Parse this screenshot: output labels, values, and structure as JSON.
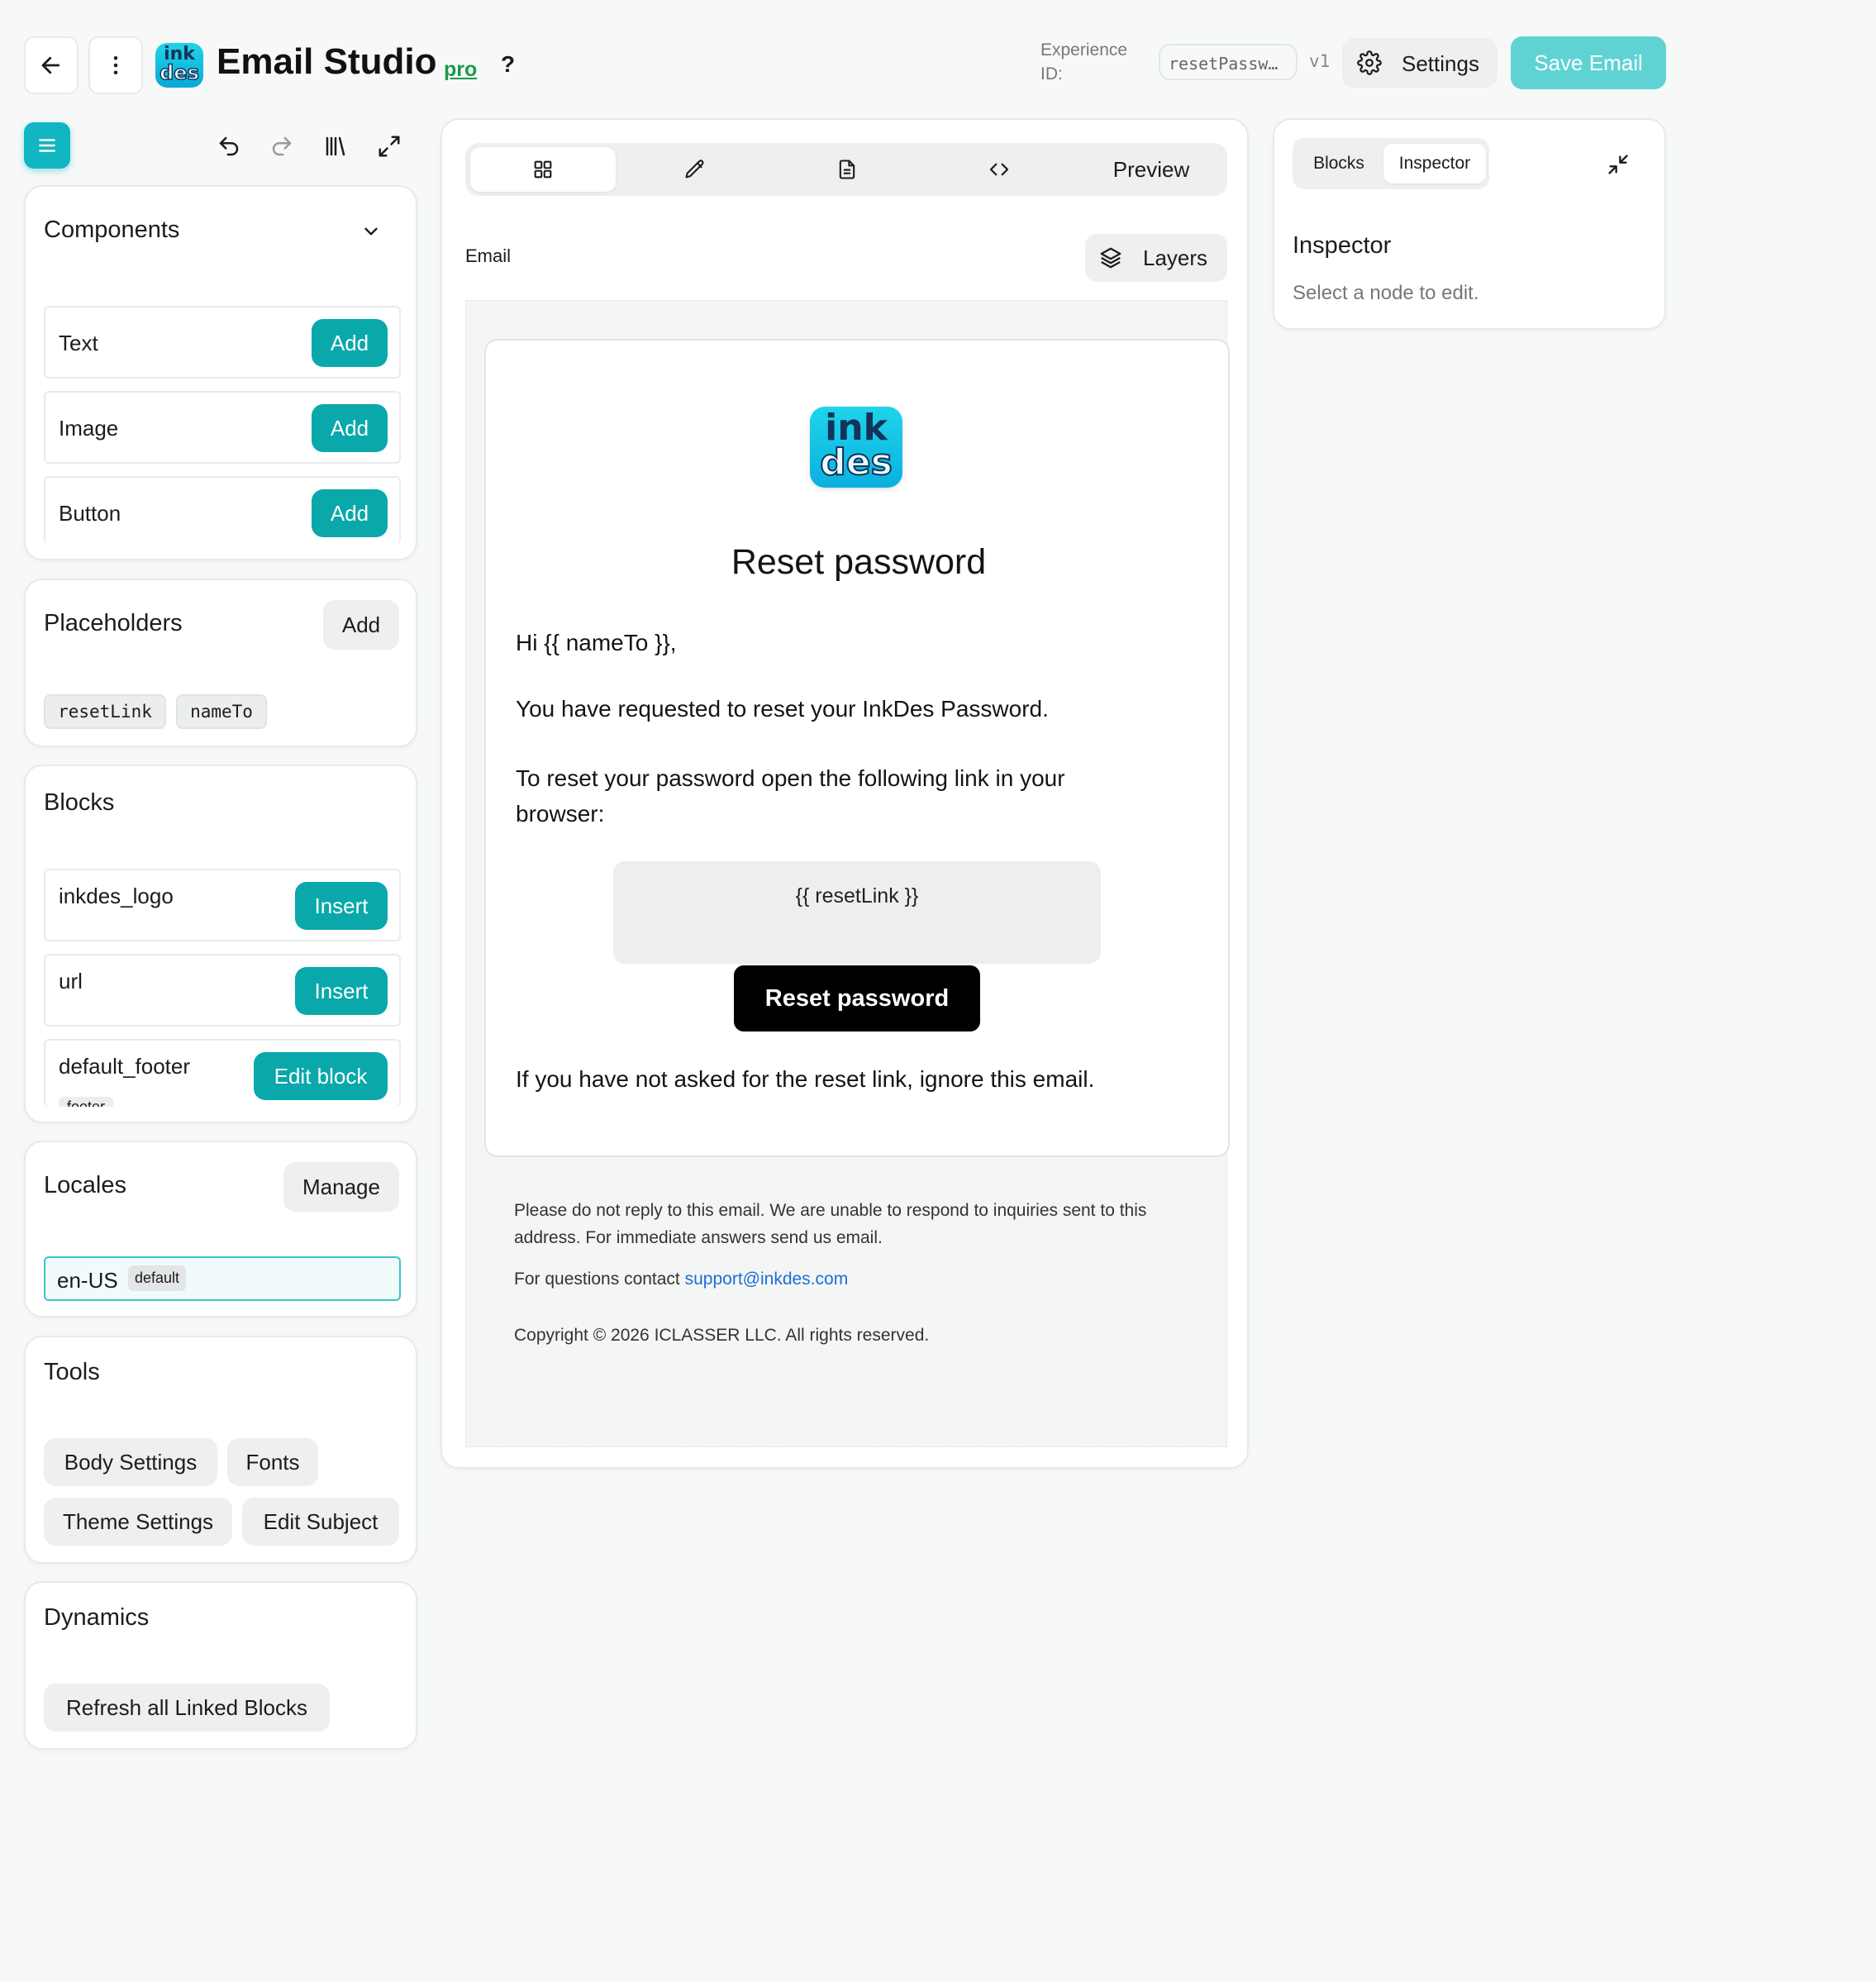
{
  "header": {
    "app_title": "Email Studio",
    "pro_badge": "pro",
    "help_label": "?",
    "logo_text_top": "ink",
    "logo_text_bottom": "des",
    "experience_id_label": "Experience ID:",
    "experience_id_value": "resetPassw…",
    "version": "v1",
    "settings_label": "Settings",
    "save_label": "Save Email"
  },
  "left": {
    "components": {
      "title": "Components",
      "items": [
        {
          "label": "Text",
          "action": "Add"
        },
        {
          "label": "Image",
          "action": "Add"
        },
        {
          "label": "Button",
          "action": "Add"
        }
      ]
    },
    "placeholders": {
      "title": "Placeholders",
      "add_label": "Add",
      "chips": [
        "resetLink",
        "nameTo"
      ]
    },
    "blocks": {
      "title": "Blocks",
      "items": [
        {
          "label": "inkdes_logo",
          "action": "Insert"
        },
        {
          "label": "url",
          "action": "Insert"
        },
        {
          "label": "default_footer",
          "action": "Edit block",
          "tag": "footer"
        }
      ]
    },
    "locales": {
      "title": "Locales",
      "manage_label": "Manage",
      "locale": "en-US",
      "locale_tag": "default"
    },
    "tools": {
      "title": "Tools",
      "buttons": [
        "Body Settings",
        "Fonts",
        "Theme Settings",
        "Edit Subject"
      ]
    },
    "dynamics": {
      "title": "Dynamics",
      "refresh_label": "Refresh all Linked Blocks"
    }
  },
  "center": {
    "preview_label": "Preview",
    "email_label": "Email",
    "layers_label": "Layers",
    "email": {
      "heading": "Reset password",
      "greeting": "Hi {{ nameTo }},",
      "para1": "You have requested to reset your InkDes Password.",
      "para2": "To reset your password open the following link in your browser:",
      "link_placeholder": "{{ resetLink }}",
      "button_label": "Reset password",
      "para3": "If you have not asked for the reset link, ignore this email.",
      "footer_note": "Please do not reply to this email. We are unable to respond to inquiries sent to this address. For immediate answers send us email.",
      "contact_prefix": "For questions contact ",
      "contact_email": "support@inkdes.com",
      "copyright": "Copyright © 2026 ICLASSER LLC. All rights reserved."
    }
  },
  "right": {
    "tabs": [
      "Blocks",
      "Inspector"
    ],
    "active_tab": "Inspector",
    "title": "Inspector",
    "hint": "Select a node to edit."
  },
  "colors": {
    "accent": "#0aa8aa",
    "save_button": "#5fd3d4",
    "pro_badge": "#1a9a4a",
    "link": "#1a6fd6"
  }
}
